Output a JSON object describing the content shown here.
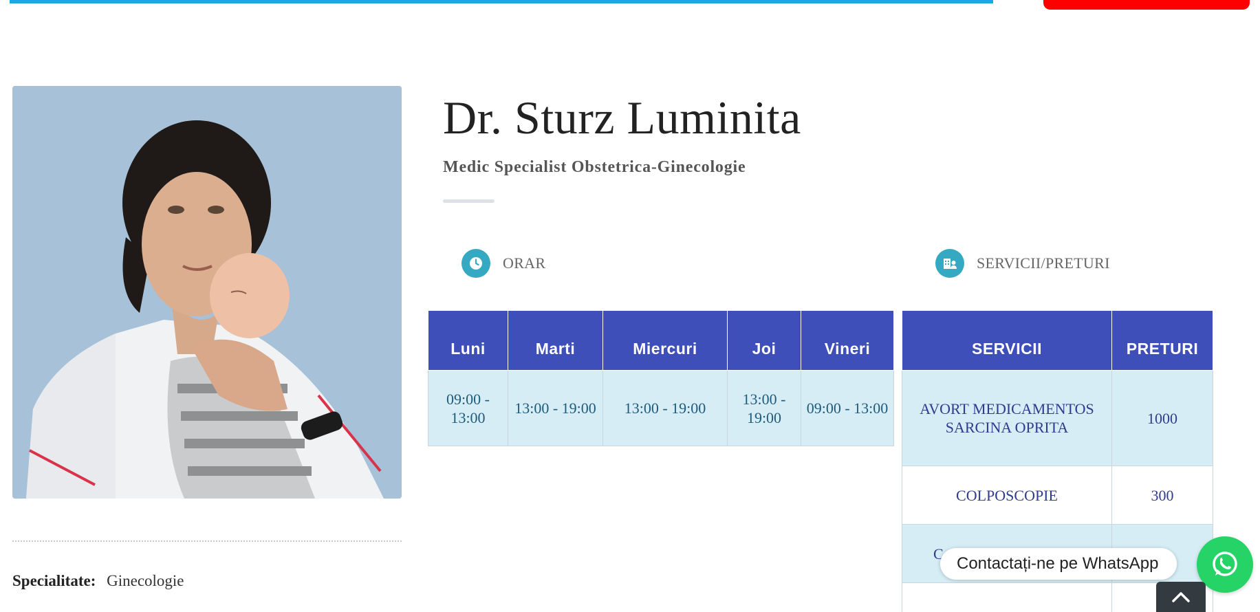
{
  "header": {
    "accent_color": "#1aa7e6",
    "cta_color": "#ff0000"
  },
  "doctor": {
    "name": "Dr. Sturz Luminita",
    "title": "Medic Specialist Obstetrica-Ginecologie",
    "photo_alt": "doctor-holding-newborn-photo"
  },
  "details": {
    "specialitate_label": "Specialitate:",
    "specialitate_value": "Ginecologie"
  },
  "orar": {
    "heading": "ORAR",
    "icon": "clock-icon",
    "days": [
      "Luni",
      "Marti",
      "Miercuri",
      "Joi",
      "Vineri"
    ],
    "hours": [
      "09:00 - 13:00",
      "13:00 - 19:00",
      "13:00 - 19:00",
      "13:00 - 19:00",
      "09:00 - 13:00"
    ]
  },
  "servicii": {
    "heading": "SERVICII/PRETURI",
    "icon": "hospital-icon",
    "col_servicii": "SERVICII",
    "col_preturi": "PRETURI",
    "rows": [
      {
        "service": "AVORT MEDICAMENTOS SARCINA OPRITA",
        "price": "1000"
      },
      {
        "service": "COLPOSCOPIE",
        "price": "300"
      },
      {
        "service": "C",
        "price": ""
      },
      {
        "service": "",
        "price": ""
      }
    ]
  },
  "whatsapp": {
    "label": "Contactați-ne pe WhatsApp",
    "color": "#25d366"
  },
  "colors": {
    "table_header": "#3f4fb9",
    "table_row_alt": "#d6edf5",
    "icon_circle": "#35a9c2"
  }
}
